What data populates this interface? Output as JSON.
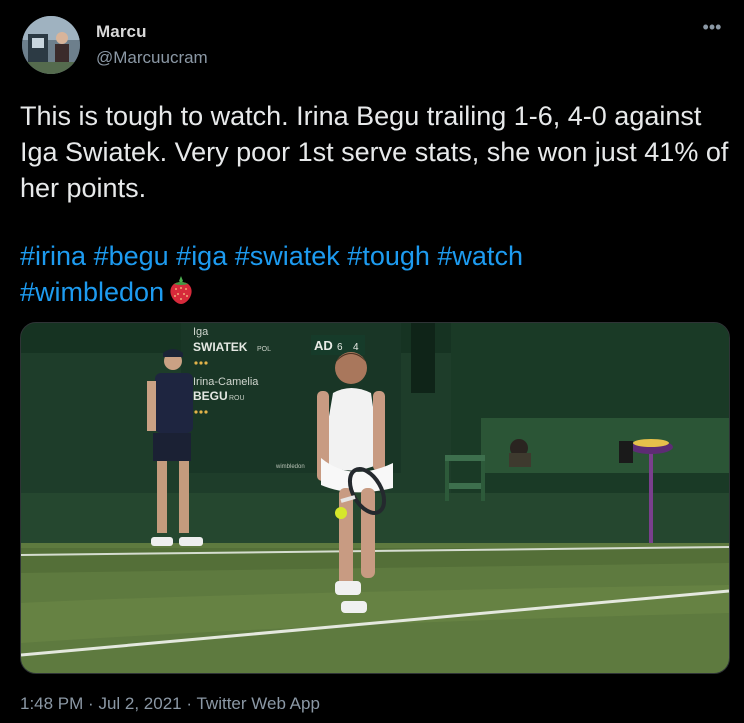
{
  "user": {
    "name": "Marcu",
    "handle": "@Marcuucram"
  },
  "menu_icon": "more-icon",
  "tweet": {
    "text": "This is tough to watch. Irina Begu trailing 1-6, 4-0 against Iga Swiatek. Very poor 1st serve stats, she won just 41% of her points.",
    "hashtags": [
      "#irina",
      "#begu",
      "#iga",
      "#swiatek",
      "#tough",
      "#watch",
      "#wimbledon"
    ],
    "emoji": "strawberry"
  },
  "scoreboard": {
    "player1_first": "Iga",
    "player1_last": "SWIATEK",
    "player1_country": "POL",
    "player2_first": "Irina-Camelia",
    "player2_last": "BEGU",
    "player2_country": "ROU",
    "advantage": "AD",
    "set1": "6",
    "set2": "4",
    "sponsor_text": "wimbledon"
  },
  "footer": {
    "time": "1:48 PM",
    "separator1": "·",
    "date": "Jul 2, 2021",
    "separator2": "·",
    "source": "Twitter Web App"
  },
  "colors": {
    "background": "#000000",
    "link": "#1d9bf0",
    "secondary_text": "#8b98a5"
  }
}
